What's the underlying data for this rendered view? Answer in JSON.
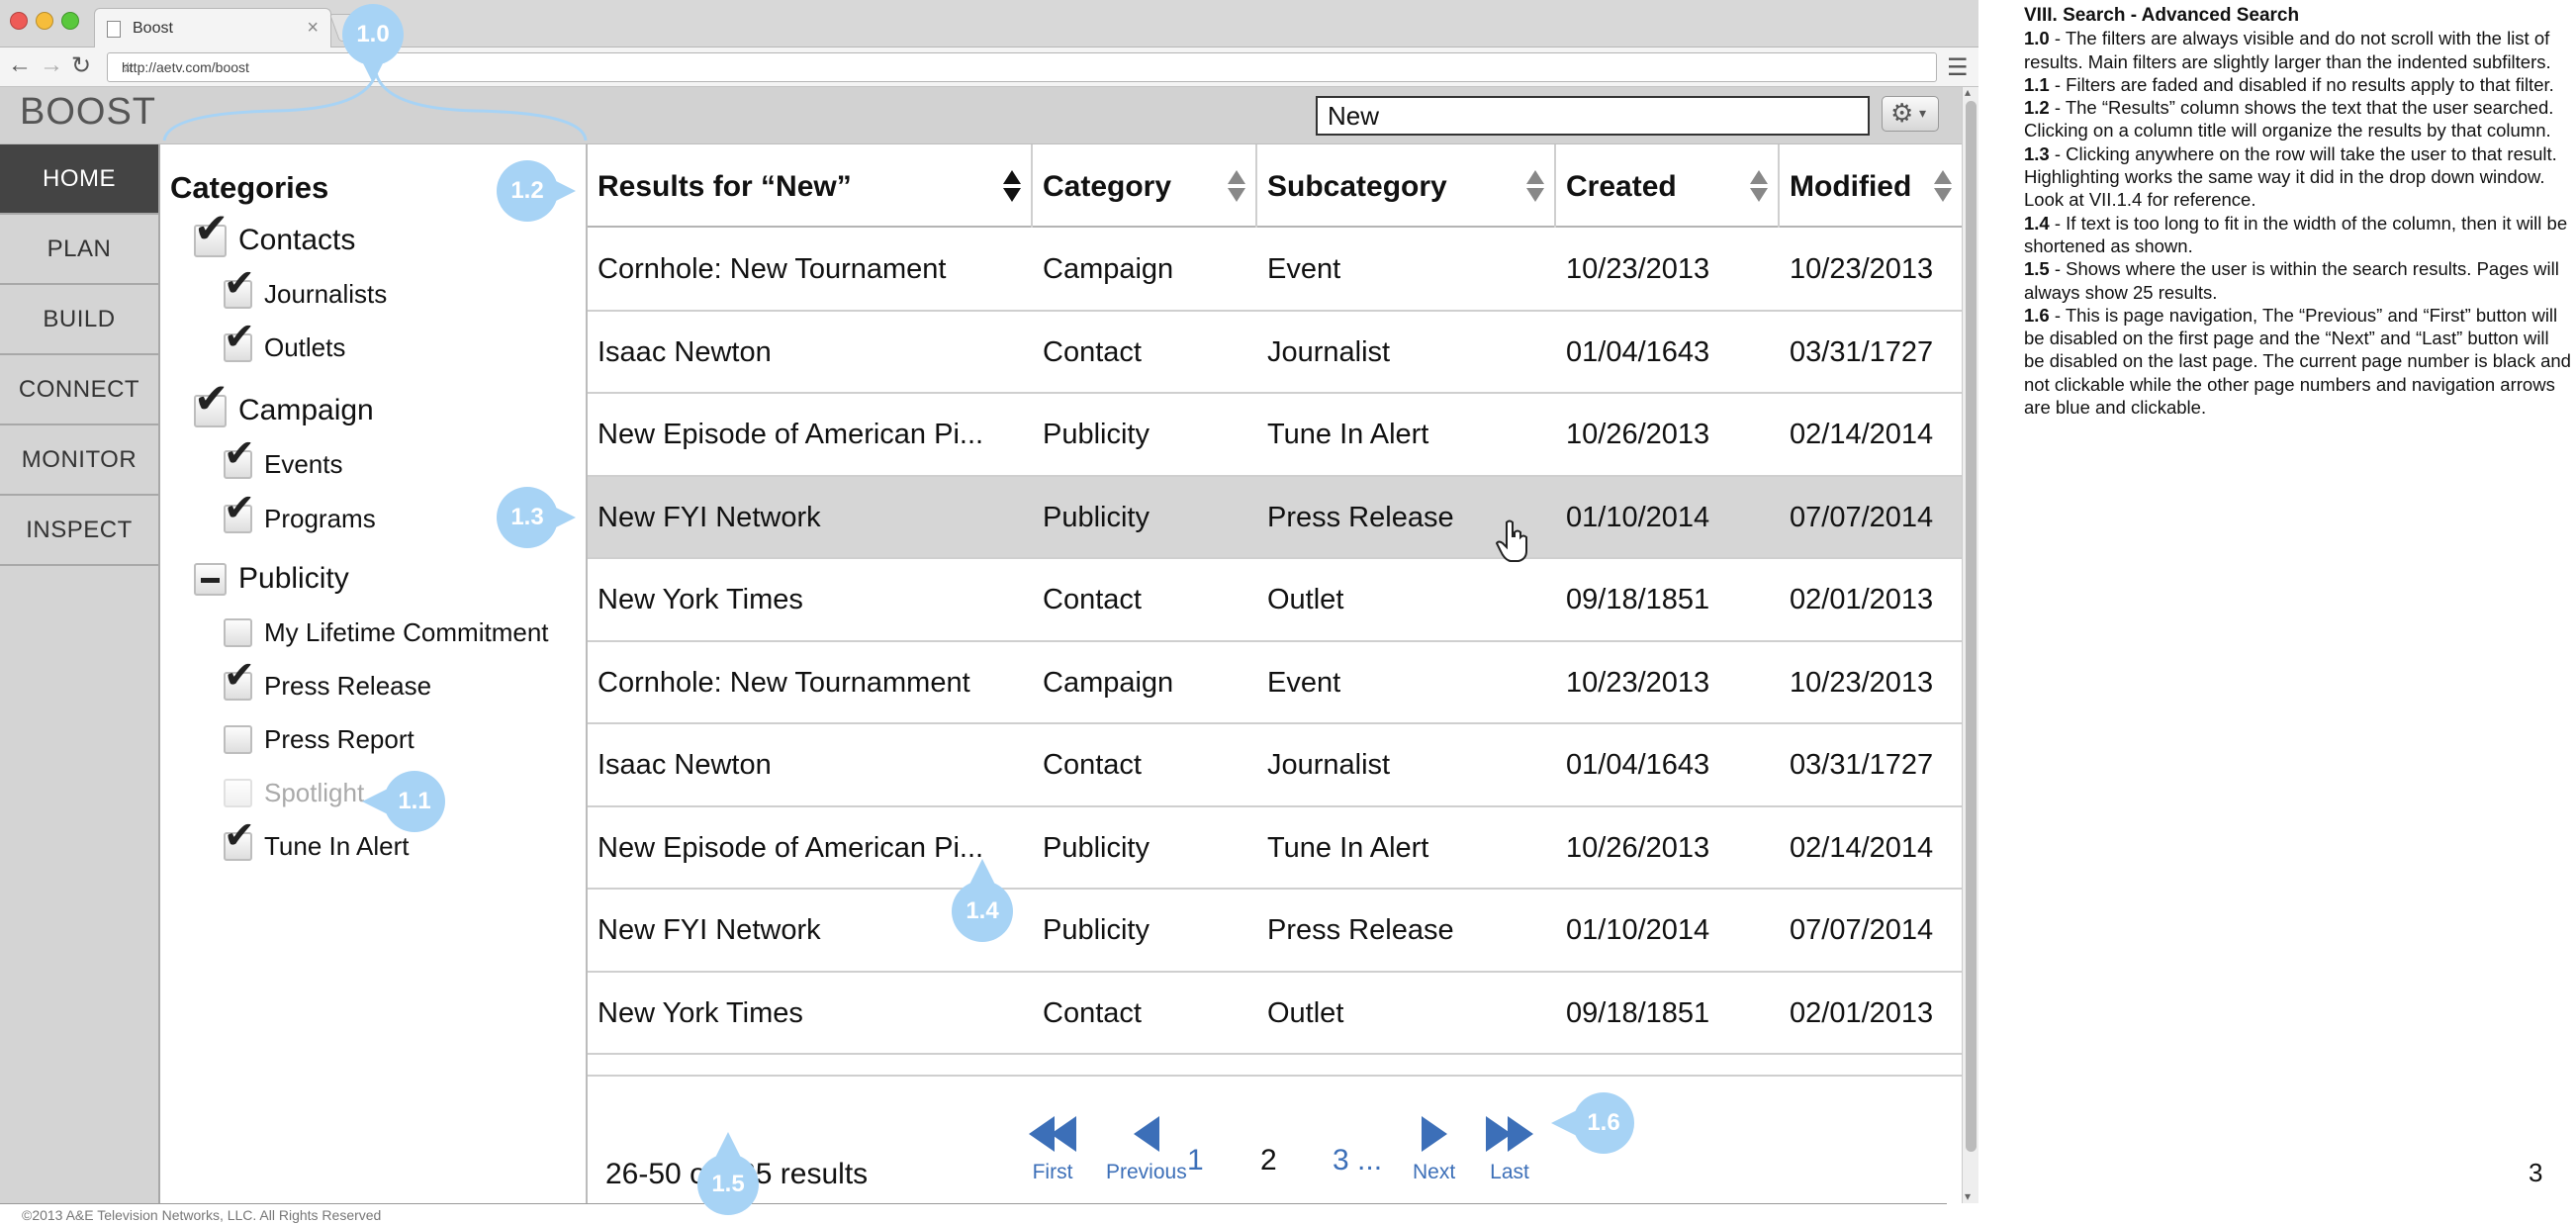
{
  "browser": {
    "tab_title": "Boost",
    "tab_close": "×",
    "url": "http://aetv.com/boost",
    "back": "←",
    "forward": "→",
    "reload": "↻",
    "star": "☆",
    "menu": "☰"
  },
  "app": {
    "logo": "BOOST",
    "search_value": "New",
    "gear": "⚙",
    "gear_caret": "▾"
  },
  "nav": {
    "items": [
      {
        "label": "HOME",
        "active": true
      },
      {
        "label": "PLAN"
      },
      {
        "label": "BUILD"
      },
      {
        "label": "CONNECT"
      },
      {
        "label": "MONITOR"
      },
      {
        "label": "INSPECT"
      }
    ]
  },
  "filters": {
    "heading": "Categories",
    "check": "✔",
    "items": [
      {
        "label": "Contacts",
        "state": "checked",
        "main": true
      },
      {
        "label": "Journalists",
        "state": "checked"
      },
      {
        "label": "Outlets",
        "state": "checked"
      },
      {
        "label": "Campaign",
        "state": "checked",
        "main": true
      },
      {
        "label": "Events",
        "state": "checked"
      },
      {
        "label": "Programs",
        "state": "checked"
      },
      {
        "label": "Publicity",
        "state": "partial",
        "main": true
      },
      {
        "label": "My Lifetime Commitment",
        "state": "unchecked"
      },
      {
        "label": "Press Release",
        "state": "checked"
      },
      {
        "label": "Press Report",
        "state": "unchecked"
      },
      {
        "label": "Spotlight",
        "state": "disabled"
      },
      {
        "label": "Tune In Alert",
        "state": "checked"
      }
    ]
  },
  "table": {
    "headers": [
      "Results for “New”",
      "Category",
      "Subcategory",
      "Created",
      "Modified"
    ],
    "rows": [
      [
        "Cornhole: New Tournament",
        "Campaign",
        "Event",
        "10/23/2013",
        "10/23/2013"
      ],
      [
        "Isaac Newton",
        "Contact",
        "Journalist",
        "01/04/1643",
        "03/31/1727"
      ],
      [
        "New Episode of American Pi...",
        "Publicity",
        "Tune In Alert",
        "10/26/2013",
        "02/14/2014"
      ],
      [
        "New FYI Network",
        "Publicity",
        "Press Release",
        "01/10/2014",
        "07/07/2014"
      ],
      [
        "New York Times",
        "Contact",
        "Outlet",
        "09/18/1851",
        "02/01/2013"
      ],
      [
        "Cornhole: New Tournamment",
        "Campaign",
        "Event",
        "10/23/2013",
        "10/23/2013"
      ],
      [
        "Isaac Newton",
        "Contact",
        "Journalist",
        "01/04/1643",
        "03/31/1727"
      ],
      [
        "New Episode of American Pi...",
        "Publicity",
        "Tune In Alert",
        "10/26/2013",
        "02/14/2014"
      ],
      [
        "New FYI Network",
        "Publicity",
        "Press Release",
        "01/10/2014",
        "07/07/2014"
      ],
      [
        "New York Times",
        "Contact",
        "Outlet",
        "09/18/1851",
        "02/01/2013"
      ]
    ]
  },
  "pagination": {
    "summary": "26-50 of 225 results",
    "first": "First",
    "previous": "Previous",
    "pages": [
      "1",
      "2",
      "3 ..."
    ],
    "current": "2",
    "next": "Next",
    "last": "Last"
  },
  "footer": "©2013 A&E Television Networks, LLC. All Rights Reserved",
  "callouts": [
    "1.0",
    "1.1",
    "1.2",
    "1.3",
    "1.4",
    "1.5",
    "1.6"
  ],
  "notes": {
    "title": "VIII. Search - Advanced Search",
    "items": [
      {
        "id": "1.0",
        "text": " - The filters are always visible and do not scroll with the list of results. Main filters are slightly larger than the indented subfilters."
      },
      {
        "id": "1.1",
        "text": " - Filters are faded and disabled if no results apply to that filter."
      },
      {
        "id": "1.2",
        "text": " - The “Results” column shows the text that the user searched. Clicking on a column title will organize the results by that column."
      },
      {
        "id": "1.3",
        "text": " - Clicking anywhere on the row will take the user to that result. Highlighting works the same way it did in the drop down window. Look at VII.1.4 for reference."
      },
      {
        "id": "1.4",
        "text": " - If text is too long to fit in the width of the column, then it will be shortened as shown."
      },
      {
        "id": "1.5",
        "text": " - Shows where the user is within the search results. Pages will always show 25 results."
      },
      {
        "id": "1.6",
        "text": " - This is page navigation, The “Previous” and “First” button will be disabled on the first page and the “Next” and “Last” button will be disabled on the last page. The current page number is black and not clickable while the other page numbers and navigation arrows are blue and clickable."
      }
    ],
    "page_number": "3"
  },
  "colors": {
    "accent_blue": "#3c6fb8",
    "callout_blue": "#a7d3f5",
    "nav_active": "#444444",
    "row_highlight": "#d6d6d6"
  }
}
